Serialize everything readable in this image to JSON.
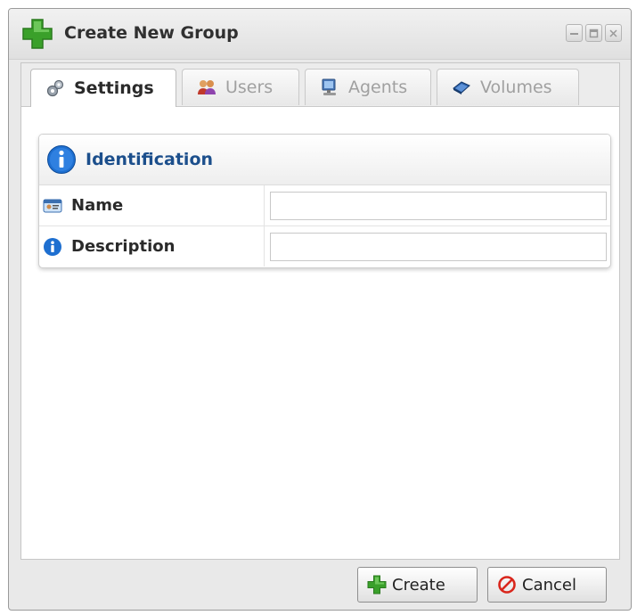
{
  "window": {
    "title": "Create New Group"
  },
  "tabs": [
    {
      "label": "Settings",
      "icon": "gears-icon",
      "active": true
    },
    {
      "label": "Users",
      "icon": "users-icon",
      "active": false
    },
    {
      "label": "Agents",
      "icon": "computer-icon",
      "active": false
    },
    {
      "label": "Volumes",
      "icon": "volume-icon",
      "active": false
    }
  ],
  "identification": {
    "title": "Identification",
    "name_label": "Name",
    "name_value": "",
    "description_label": "Description",
    "description_value": ""
  },
  "footer": {
    "create_label": "Create",
    "cancel_label": "Cancel"
  },
  "colors": {
    "panel_title": "#1c4f8c",
    "info_blue": "#1e6fd0",
    "create_green": "#3aa02a",
    "cancel_red": "#d9261c"
  }
}
